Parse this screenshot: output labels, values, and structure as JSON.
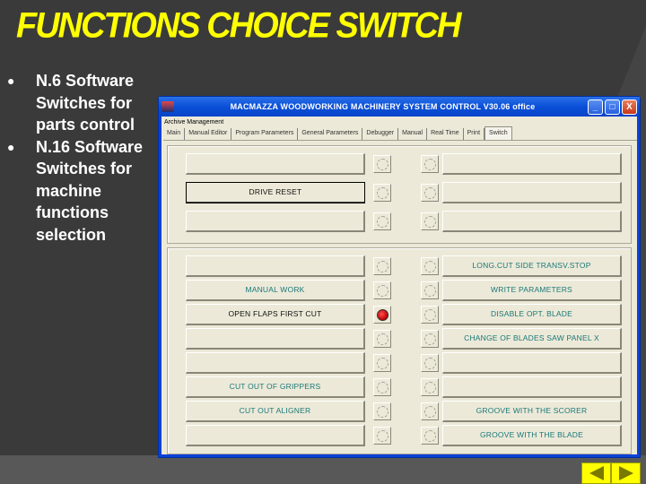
{
  "slide": {
    "title": "FUNCTIONS CHOICE SWITCH",
    "bullets": [
      "N.6 Software Switches for parts control",
      "N.16 Software Switches for machine functions selection"
    ]
  },
  "window": {
    "title": "MACMAZZA WOODWORKING MACHINERY SYSTEM CONTROL  V30.06 office",
    "controls": {
      "minimize": "_",
      "maximize": "□",
      "close": "X"
    },
    "menu": [
      "Archive Management"
    ],
    "tabs": [
      {
        "label": "Main",
        "active": false
      },
      {
        "label": "Manual Editor",
        "active": false
      },
      {
        "label": "Program Parameters",
        "active": false
      },
      {
        "label": "General Parameters",
        "active": false
      },
      {
        "label": "Debugger",
        "active": false
      },
      {
        "label": "Manual",
        "active": false
      },
      {
        "label": "Real Time",
        "active": false
      },
      {
        "label": "Print",
        "active": false
      },
      {
        "label": "Switch",
        "active": true
      }
    ]
  },
  "parts_switches": [
    {
      "left_label": "",
      "left_led": "off",
      "right_led": "off",
      "right_label": ""
    },
    {
      "left_label": "DRIVE RESET",
      "left_led": "off",
      "right_led": "off",
      "right_label": ""
    },
    {
      "left_label": "",
      "left_led": "off",
      "right_led": "off",
      "right_label": ""
    }
  ],
  "function_switches": [
    {
      "left_label": "",
      "left_led": "off",
      "right_led": "off",
      "right_label": "LONG.CUT SIDE TRANSV.STOP"
    },
    {
      "left_label": "MANUAL WORK",
      "left_led": "off",
      "right_led": "off",
      "right_label": "WRITE PARAMETERS"
    },
    {
      "left_label": "OPEN FLAPS FIRST CUT",
      "left_led": "on",
      "right_led": "off",
      "right_label": "DISABLE OPT. BLADE"
    },
    {
      "left_label": "",
      "left_led": "off",
      "right_led": "off",
      "right_label": "CHANGE OF BLADES SAW PANEL X"
    },
    {
      "left_label": "",
      "left_led": "off",
      "right_led": "off",
      "right_label": ""
    },
    {
      "left_label": "CUT OUT OF GRIPPERS",
      "left_led": "off",
      "right_led": "off",
      "right_label": ""
    },
    {
      "left_label": "CUT OUT ALIGNER",
      "left_led": "off",
      "right_led": "off",
      "right_label": "GROOVE WITH THE SCORER"
    },
    {
      "left_label": "",
      "left_led": "off",
      "right_led": "off",
      "right_label": "GROOVE WITH THE BLADE"
    }
  ],
  "nav": {
    "prev": "previous-slide",
    "next": "next-slide"
  }
}
